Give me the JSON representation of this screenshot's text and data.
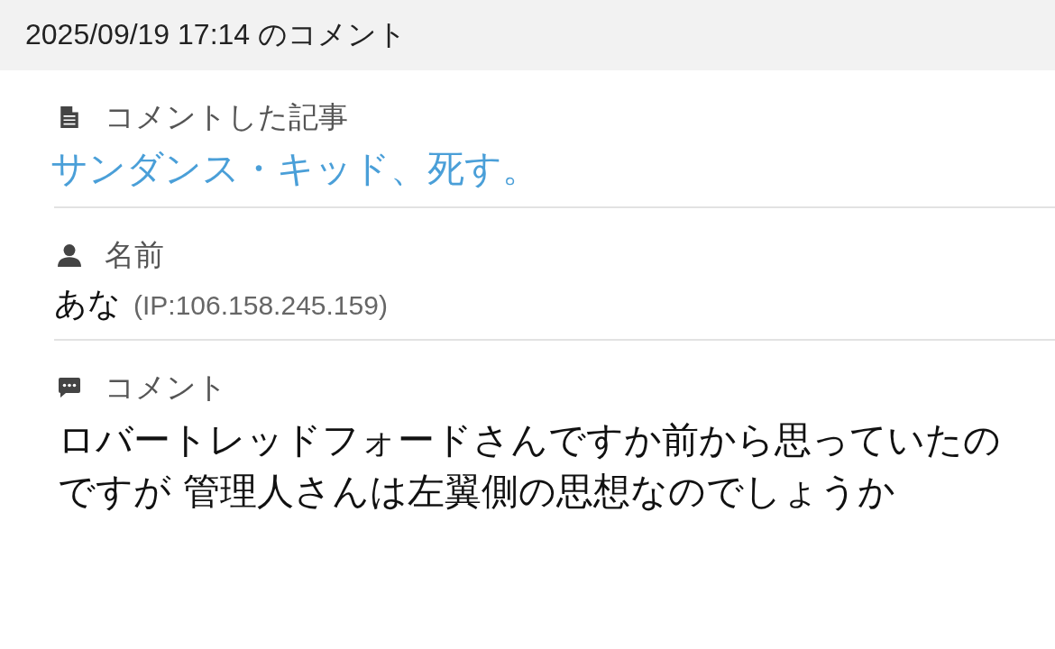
{
  "header": {
    "title": "2025/09/19 17:14 のコメント"
  },
  "sections": [
    {
      "kind": "article",
      "label": "コメントした記事",
      "value": "サンダンス・キッド、死す。"
    },
    {
      "kind": "name",
      "label": "名前",
      "value": "あな",
      "note": "(IP:106.158.245.159)"
    },
    {
      "kind": "comment",
      "label": "コメント",
      "value": "ロバートレッドフォードさんですか前から思っていたのですが 管理人さんは左翼側の思想なのでしょうか"
    }
  ]
}
